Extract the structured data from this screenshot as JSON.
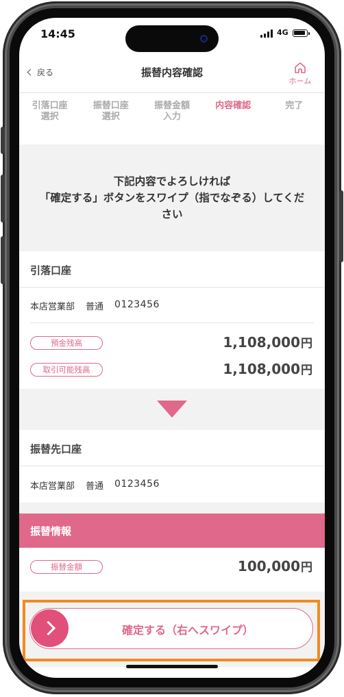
{
  "status": {
    "time": "14:45",
    "network": "4G"
  },
  "header": {
    "back_label": "戻る",
    "title": "振替内容確認",
    "home_label": "ホーム"
  },
  "steps": [
    {
      "label": "引落口座\n選択",
      "active": false
    },
    {
      "label": "振替口座\n選択",
      "active": false
    },
    {
      "label": "振替金額\n入力",
      "active": false
    },
    {
      "label": "内容確認",
      "active": true
    },
    {
      "label": "完了",
      "active": false
    }
  ],
  "instruction": "下記内容でよろしければ\n「確定する」ボタンをスワイプ（指でなぞる）してください",
  "debit_account": {
    "section_label": "引落口座",
    "branch": "本店営業部",
    "type": "普通",
    "number": "0123456",
    "balance_label": "預金残高",
    "balance_value": "1,108,000",
    "available_label": "取引可能残高",
    "available_value": "1,108,000",
    "currency": "円"
  },
  "credit_account": {
    "section_label": "振替先口座",
    "branch": "本店営業部",
    "type": "普通",
    "number": "0123456"
  },
  "transfer_info": {
    "section_label": "振替情報",
    "amount_label": "振替金額",
    "amount_value": "100,000",
    "currency": "円"
  },
  "swipe": {
    "label": "確定する（右へスワイプ）"
  },
  "colors": {
    "accent": "#e0688a",
    "highlight": "#f28a1e",
    "background_gray": "#f2f2f2"
  },
  "icons": [
    "back-chevron-icon",
    "home-icon",
    "down-triangle-icon",
    "swipe-chevron-icon"
  ]
}
